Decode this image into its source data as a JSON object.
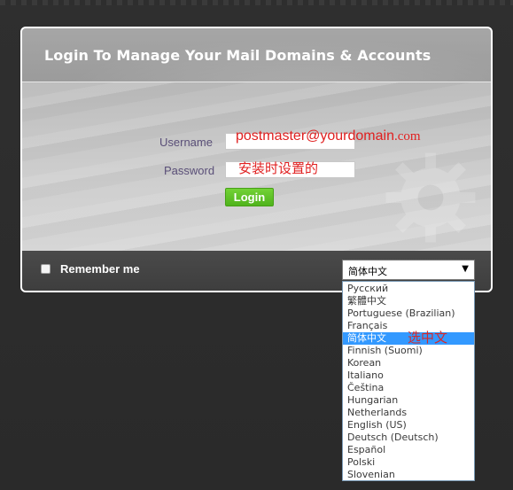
{
  "login": {
    "title": "Login To Manage Your Mail Domains & Accounts",
    "username_label": "Username",
    "password_label": "Password",
    "username_value": "",
    "password_value": "",
    "button_label": "Login"
  },
  "annotations": {
    "username_note_main": "postmaster@yourdomain",
    "username_note_suffix": ".com",
    "password_note": "安装时设置的",
    "language_note": "选中文"
  },
  "footer": {
    "remember_label": "Remember me",
    "remember_checked": false
  },
  "language": {
    "selected": "简体中文",
    "arrow_icon": "▼",
    "highlight_color": "#3399ff",
    "options": [
      "Русский",
      "繁體中文",
      "Portuguese (Brazilian)",
      "Français",
      "简体中文",
      "Finnish (Suomi)",
      "Korean",
      "Italiano",
      "Čeština",
      "Hungarian",
      "Netherlands",
      "English (US)",
      "Deutsch (Deutsch)",
      "Español",
      "Polski",
      "Slovenian"
    ],
    "highlighted_index": 4
  },
  "colors": {
    "login_button": "#5cc026",
    "annotation_red": "#e02020",
    "label_purple": "#5a4f78"
  }
}
